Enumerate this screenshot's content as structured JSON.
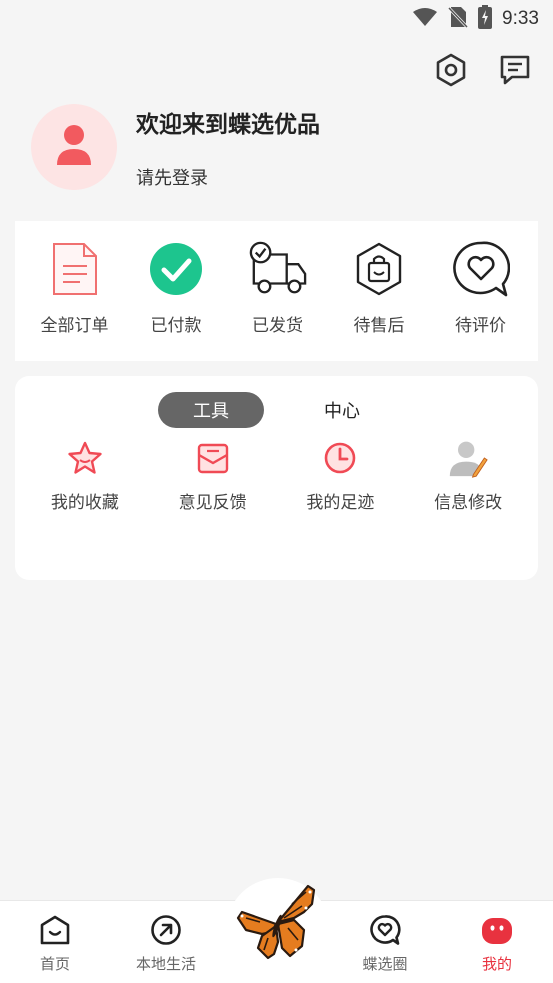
{
  "status_bar": {
    "time": "9:33",
    "icons": [
      "wifi-icon",
      "no-sim-icon",
      "battery-charging-icon"
    ]
  },
  "header": {
    "icons": [
      "settings-icon",
      "message-icon"
    ]
  },
  "profile": {
    "welcome": "欢迎来到蝶选优品",
    "login_hint": "请先登录",
    "avatar_icon": "user-icon"
  },
  "orders": {
    "items": [
      {
        "label": "全部订单",
        "icon": "document-icon"
      },
      {
        "label": "已付款",
        "icon": "check-circle-icon"
      },
      {
        "label": "已发货",
        "icon": "delivery-truck-icon"
      },
      {
        "label": "待售后",
        "icon": "shopping-bag-icon"
      },
      {
        "label": "待评价",
        "icon": "heart-chat-icon"
      }
    ]
  },
  "tools": {
    "tabs": [
      {
        "label": "工具",
        "active": true
      },
      {
        "label": "中心",
        "active": false
      }
    ],
    "items": [
      {
        "label": "我的收藏",
        "icon": "star-icon"
      },
      {
        "label": "意见反馈",
        "icon": "mail-icon"
      },
      {
        "label": "我的足迹",
        "icon": "clock-icon"
      },
      {
        "label": "信息修改",
        "icon": "user-edit-icon"
      }
    ]
  },
  "bottom_nav": {
    "items": [
      {
        "label": "首页",
        "icon": "home-smile-icon",
        "active": false
      },
      {
        "label": "本地生活",
        "icon": "compass-arrow-icon",
        "active": false
      },
      {
        "label": "",
        "icon": "butterfly-icon",
        "active": false
      },
      {
        "label": "蝶选圈",
        "icon": "heart-bubble-icon",
        "active": false
      },
      {
        "label": "我的",
        "icon": "face-icon",
        "active": true
      }
    ]
  },
  "colors": {
    "accent": "#e8323f",
    "pink_light": "#fde4e4",
    "green_check": "#1dc58e",
    "tab_active_bg": "#666666"
  }
}
